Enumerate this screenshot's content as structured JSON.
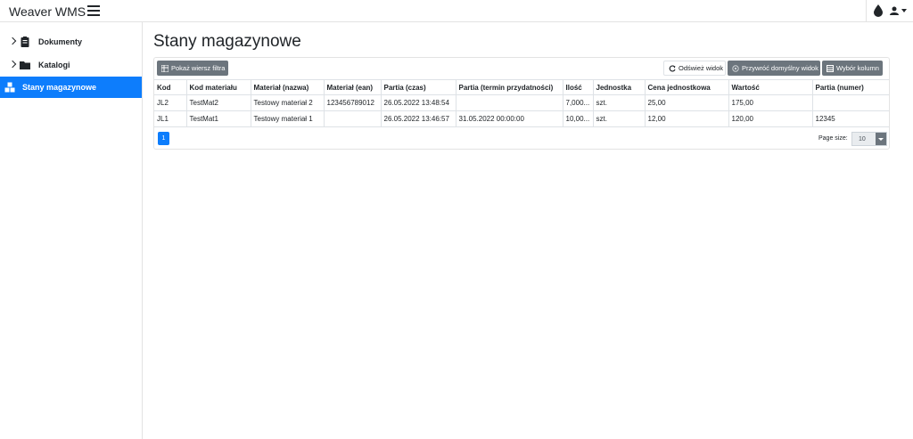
{
  "app": {
    "title": "Weaver WMS"
  },
  "sidebar": {
    "items": [
      {
        "label": "Dokumenty",
        "icon": "clipboard-icon"
      },
      {
        "label": "Katalogi",
        "icon": "folder-icon"
      },
      {
        "label": "Stany magazynowe",
        "icon": "boxes-icon",
        "active": true
      }
    ]
  },
  "page": {
    "title": "Stany magazynowe"
  },
  "toolbar": {
    "filter_label": "Pokaż wiersz filtra",
    "refresh_label": "Odśwież widok",
    "restore_label": "Przywróć domyślny widok",
    "columns_label": "Wybór kolumn"
  },
  "table": {
    "headers": [
      "Kod",
      "Kod materiału",
      "Materiał (nazwa)",
      "Materiał (ean)",
      "Partia (czas)",
      "Partia (termin przydatności)",
      "Ilość",
      "Jednostka",
      "Cena jednostkowa",
      "Wartość",
      "Partia (numer)"
    ],
    "rows": [
      [
        "JL2",
        "TestMat2",
        "Testowy materiał 2",
        "123456789012",
        "26.05.2022 13:48:54",
        "",
        "7,000...",
        "szt.",
        "25,00",
        "175,00",
        ""
      ],
      [
        "JL1",
        "TestMat1",
        "Testowy materiał 1",
        "",
        "26.05.2022 13:46:57",
        "31.05.2022 00:00:00",
        "10,00...",
        "szt.",
        "12,00",
        "120,00",
        "12345"
      ]
    ]
  },
  "pager": {
    "current_page": "1",
    "page_size_label": "Page size:",
    "page_size": "10"
  },
  "colors": {
    "accent": "#0d7dfc",
    "secondary": "#6c757d"
  }
}
